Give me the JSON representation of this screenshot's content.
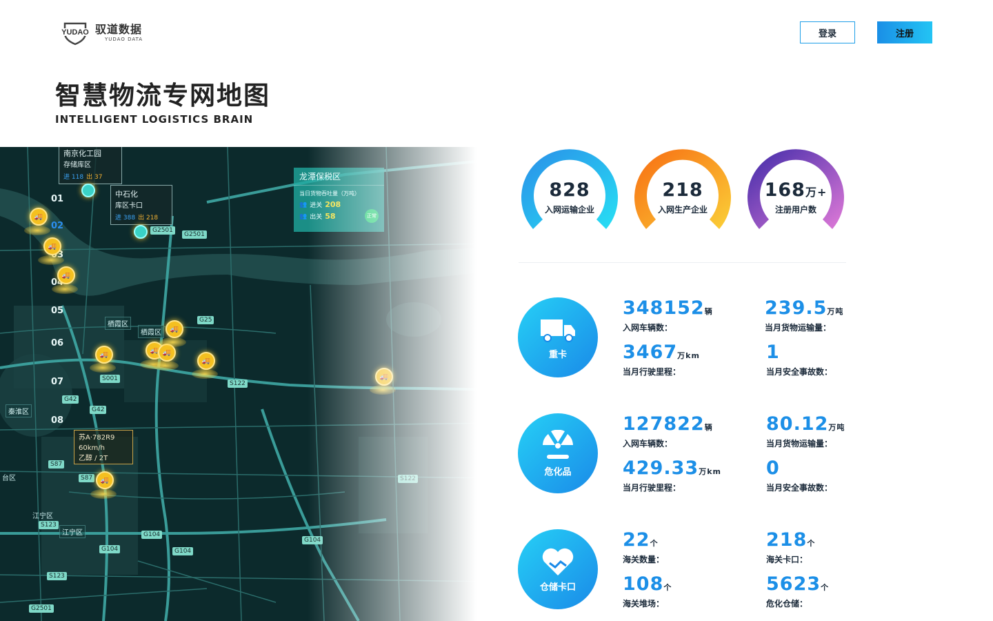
{
  "header": {
    "logo_en": "YUDAO",
    "logo_cn": "驭道数据",
    "logo_sub": "YUDAO DATA",
    "login": "登录",
    "register": "注册"
  },
  "page": {
    "title": "智慧物流专网地图",
    "subtitle": "INTELLIGENT LOGISTICS BRAIN"
  },
  "colors": {
    "accent": "#1c8fe7",
    "map_bg": "#0c2a2c",
    "pin": "#f4c020"
  },
  "map": {
    "numbers": [
      "01",
      "02",
      "03",
      "04",
      "05",
      "06",
      "07",
      "08"
    ],
    "active_number": "02",
    "nanjing": {
      "title": "南京化工园",
      "sub": "存储库区",
      "in_label": "进",
      "in": "118",
      "out_label": "出",
      "out": "37"
    },
    "sinopec": {
      "title": "中石化",
      "sub": "库区卡口",
      "in_label": "进",
      "in": "388",
      "out_label": "出",
      "out": "218"
    },
    "longtan": {
      "title": "龙潭保税区",
      "sub": "当日货物吞吐量（万吨）",
      "in_label": "进关",
      "in": "208",
      "out_label": "出关",
      "out": "58",
      "status": "正常"
    },
    "vehicle": {
      "plate": "苏A·782R9",
      "speed": "60km/h",
      "cargo": "乙醇 / 2T"
    },
    "places": [
      "栖霞区",
      "栖霞区",
      "秦淮区",
      "江宁区",
      "江宁区",
      "台区",
      "南京化工园"
    ],
    "roads": [
      "G2501",
      "G25",
      "S122",
      "S001",
      "G42",
      "G42",
      "S87",
      "S87",
      "G104",
      "G104",
      "G104",
      "G104",
      "S123",
      "S123",
      "G2501",
      "S122",
      "G2501"
    ]
  },
  "gauges": [
    {
      "value": "828",
      "unit": "",
      "label": "入网运输企业"
    },
    {
      "value": "218",
      "unit": "",
      "label": "入网生产企业"
    },
    {
      "value": "168",
      "unit": "万+",
      "label": "注册用户数"
    }
  ],
  "categories": [
    {
      "name": "重卡",
      "icon": "truck-icon",
      "metrics": [
        {
          "value": "348152",
          "unit": "辆",
          "label": "入网车辆数："
        },
        {
          "value": "239.5",
          "unit": "万吨",
          "label": "当月货物运输量："
        },
        {
          "value": "3467",
          "unit": "万km",
          "label": "当月行驶里程："
        },
        {
          "value": "1",
          "unit": "",
          "label": "当月安全事故数："
        }
      ]
    },
    {
      "name": "危化品",
      "icon": "radiation-icon",
      "metrics": [
        {
          "value": "127822",
          "unit": "辆",
          "label": "入网车辆数："
        },
        {
          "value": "80.12",
          "unit": "万吨",
          "label": "当月货物运输量："
        },
        {
          "value": "429.33",
          "unit": "万km",
          "label": "当月行驶里程："
        },
        {
          "value": "0",
          "unit": "",
          "label": "当月安全事故数："
        }
      ]
    },
    {
      "name": "仓储卡口",
      "icon": "handshake-heart-icon",
      "metrics": [
        {
          "value": "22",
          "unit": "个",
          "label": "海关数量："
        },
        {
          "value": "218",
          "unit": "个",
          "label": "海关卡口："
        },
        {
          "value": "108",
          "unit": "个",
          "label": "海关堆场："
        },
        {
          "value": "5623",
          "unit": "个",
          "label": "危化仓储："
        }
      ]
    }
  ]
}
